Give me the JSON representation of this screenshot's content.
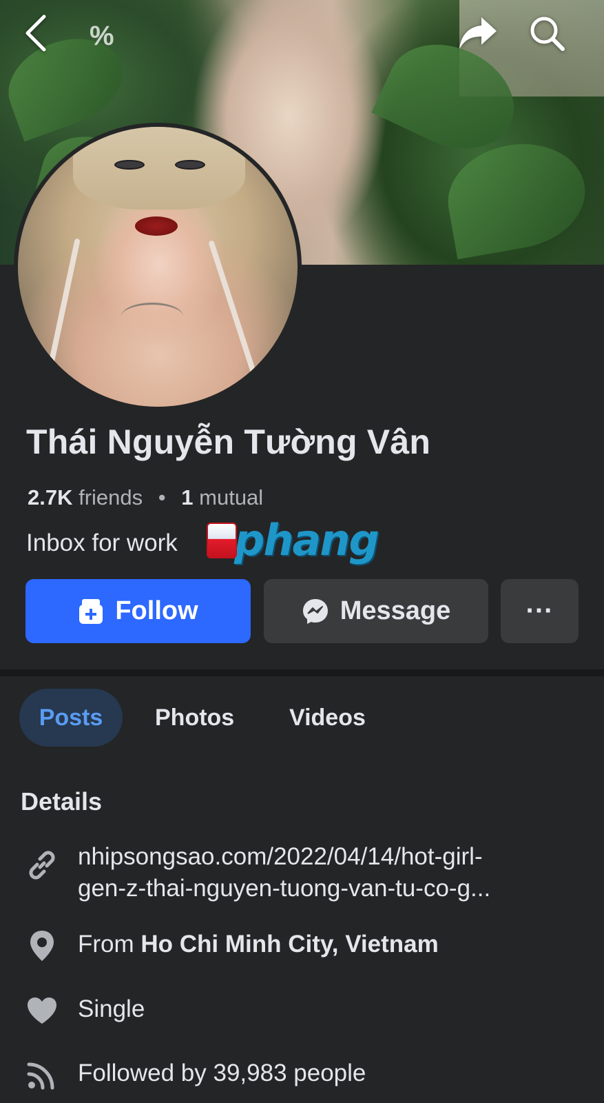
{
  "top_bar": {
    "back_icon": "chevron-left-icon",
    "share_icon": "share-arrow-icon",
    "search_icon": "search-icon"
  },
  "cover": {
    "overlay_glyph": "%"
  },
  "profile": {
    "name": "Thái Nguyễn Tường Vân",
    "friends_count": "2.7K",
    "friends_label": "friends",
    "mutual_count": "1",
    "mutual_label": "mutual",
    "bio": "Inbox for work",
    "watermark_text": "phang"
  },
  "actions": {
    "follow_label": "Follow",
    "message_label": "Message",
    "more_label": "···"
  },
  "tabs": [
    {
      "label": "Posts",
      "active": true
    },
    {
      "label": "Photos",
      "active": false
    },
    {
      "label": "Videos",
      "active": false
    }
  ],
  "details": {
    "title": "Details",
    "link_line1": "nhipsongsao.com/2022/04/14/hot-girl-",
    "link_line2": "gen-z-thai-nguyen-tuong-van-tu-co-g...",
    "from_prefix": "From",
    "from_value": "Ho Chi Minh City, Vietnam",
    "relationship": "Single",
    "followed_by": "Followed by 39,983 people"
  },
  "colors": {
    "background": "#242526",
    "follow_button": "#2d68ff",
    "secondary_button": "#3a3b3c",
    "active_tab_bg": "#263951",
    "active_tab_text": "#5b9bf2"
  }
}
